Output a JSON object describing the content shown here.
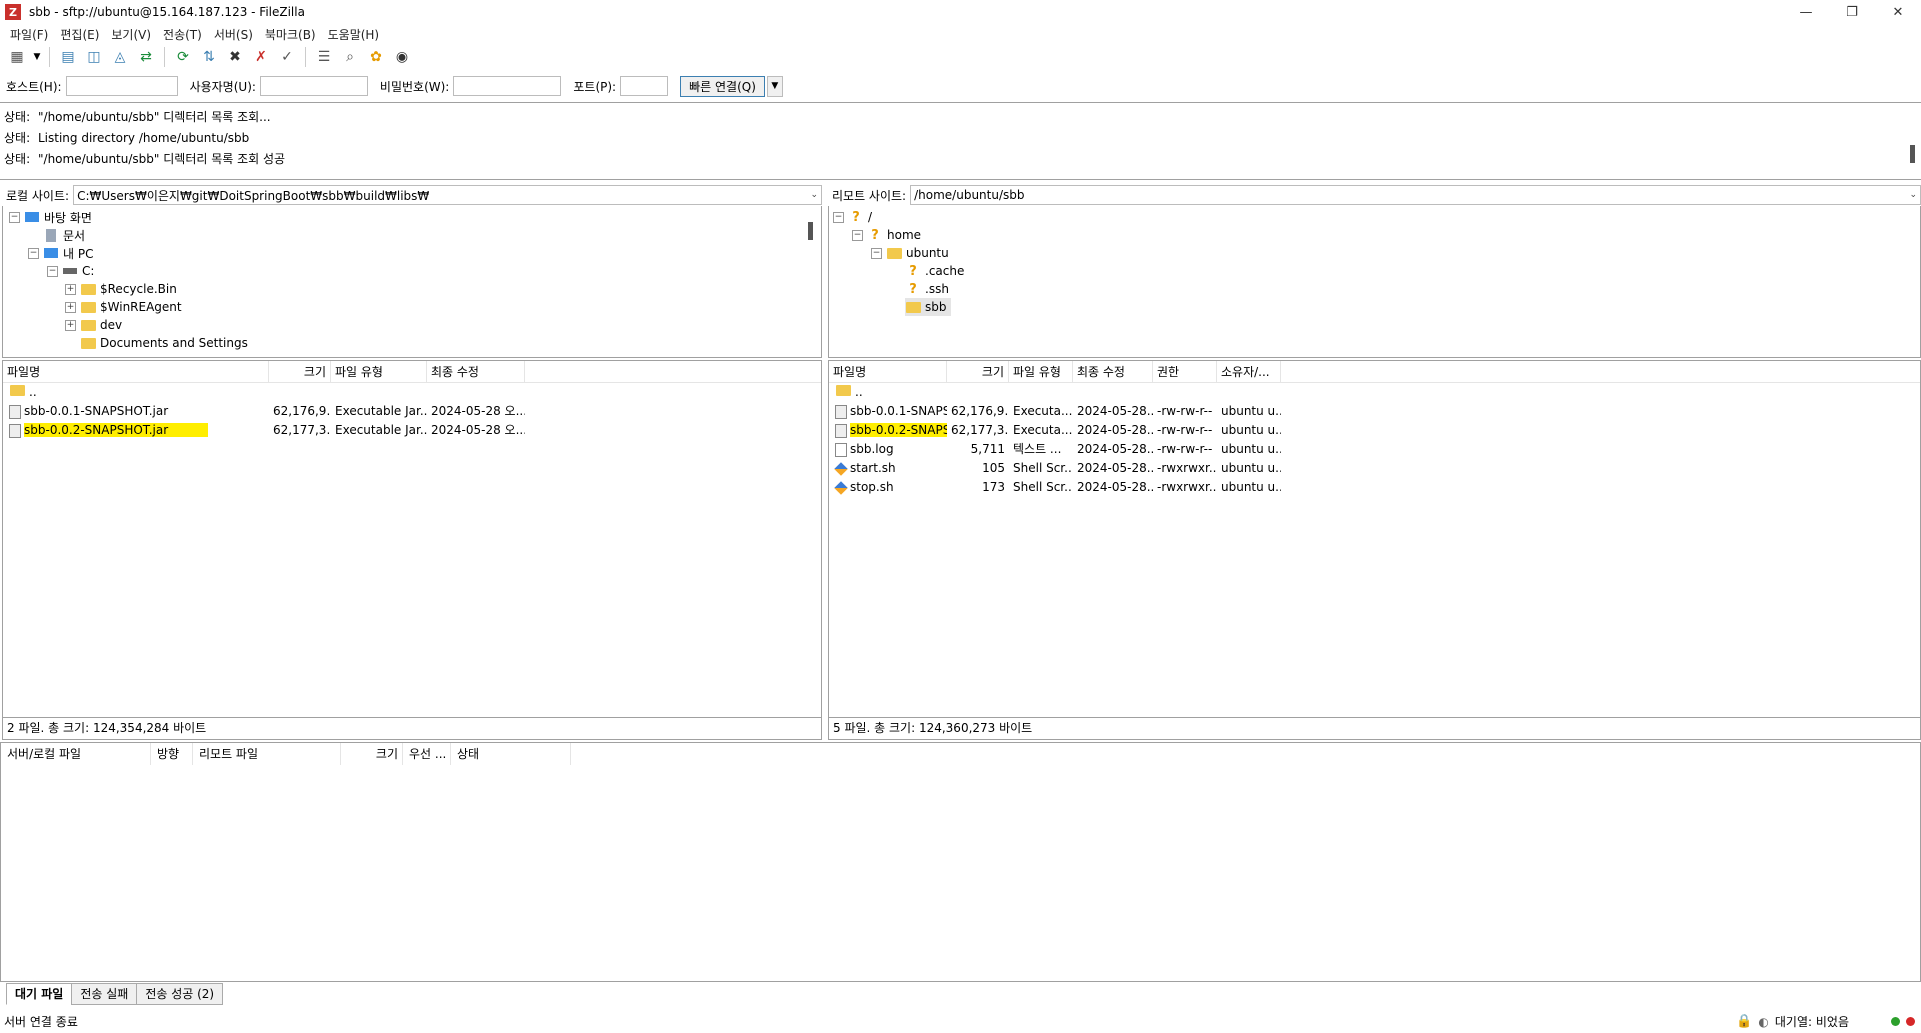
{
  "window": {
    "title": "sbb - sftp://ubuntu@15.164.187.123 - FileZilla",
    "app_icon_letter": "Z"
  },
  "menu": [
    "파일(F)",
    "편집(E)",
    "보기(V)",
    "전송(T)",
    "서버(S)",
    "북마크(B)",
    "도움말(H)"
  ],
  "quickconnect": {
    "host_label": "호스트(H):",
    "host_value": "",
    "user_label": "사용자명(U):",
    "user_value": "",
    "pass_label": "비밀번호(W):",
    "pass_value": "",
    "port_label": "포트(P):",
    "port_value": "",
    "connect_label": "빠른 연결(Q)"
  },
  "log": [
    {
      "tag": "상태:",
      "text": "\"/home/ubuntu/sbb\" 디렉터리 목록 조회..."
    },
    {
      "tag": "상태:",
      "text": "Listing directory /home/ubuntu/sbb"
    },
    {
      "tag": "상태:",
      "text": "\"/home/ubuntu/sbb\" 디렉터리 목록 조회 성공"
    }
  ],
  "local": {
    "label": "로컬 사이트:",
    "path": "C:₩Users₩이은지₩git₩DoitSpringBoot₩sbb₩build₩libs₩",
    "tree": [
      "바탕 화면",
      "문서",
      "내 PC",
      "C:",
      "$Recycle.Bin",
      "$WinREAgent",
      "dev",
      "Documents and Settings"
    ],
    "columns": [
      "파일명",
      "크기",
      "파일 유형",
      "최종 수정"
    ],
    "parent": "..",
    "files": [
      {
        "name": "sbb-0.0.1-SNAPSHOT.jar",
        "size": "62,176,9...",
        "type": "Executable Jar...",
        "modified": "2024-05-28 오..."
      },
      {
        "name": "sbb-0.0.2-SNAPSHOT.jar",
        "size": "62,177,3...",
        "type": "Executable Jar...",
        "modified": "2024-05-28 오..."
      }
    ],
    "status": "2 파일. 총 크기: 124,354,284 바이트"
  },
  "remote": {
    "label": "리모트 사이트:",
    "path": "/home/ubuntu/sbb",
    "tree": [
      "/",
      "home",
      "ubuntu",
      ".cache",
      ".ssh",
      "sbb"
    ],
    "columns": [
      "파일명",
      "크기",
      "파일 유형",
      "최종 수정",
      "권한",
      "소유자/..."
    ],
    "parent": "..",
    "files": [
      {
        "name": "sbb-0.0.1-SNAPS...",
        "size": "62,176,9...",
        "type": "Executa...",
        "modified": "2024-05-28...",
        "perm": "-rw-rw-r--",
        "owner": "ubuntu u..."
      },
      {
        "name": "sbb-0.0.2-SNAPS...",
        "size": "62,177,3...",
        "type": "Executa...",
        "modified": "2024-05-28...",
        "perm": "-rw-rw-r--",
        "owner": "ubuntu u..."
      },
      {
        "name": "sbb.log",
        "size": "5,711",
        "type": "텍스트 ...",
        "modified": "2024-05-28...",
        "perm": "-rw-rw-r--",
        "owner": "ubuntu u..."
      },
      {
        "name": "start.sh",
        "size": "105",
        "type": "Shell Scr...",
        "modified": "2024-05-28...",
        "perm": "-rwxrwxr...",
        "owner": "ubuntu u..."
      },
      {
        "name": "stop.sh",
        "size": "173",
        "type": "Shell Scr...",
        "modified": "2024-05-28...",
        "perm": "-rwxrwxr...",
        "owner": "ubuntu u..."
      }
    ],
    "status": "5 파일. 총 크기: 124,360,273 바이트"
  },
  "queue": {
    "columns": [
      "서버/로컬 파일",
      "방향",
      "리모트 파일",
      "크기",
      "우선 ...",
      "상태"
    ]
  },
  "tabs": [
    "대기 파일",
    "전송 실패",
    "전송 성공 (2)"
  ],
  "statusbar": {
    "left": "서버 연결 종료",
    "queue": "대기열: 비었음"
  },
  "colors": {
    "highlight": "#ffee00",
    "accent": "#3c7fb1",
    "dot_green": "#2ca02c",
    "dot_red": "#d62728"
  }
}
